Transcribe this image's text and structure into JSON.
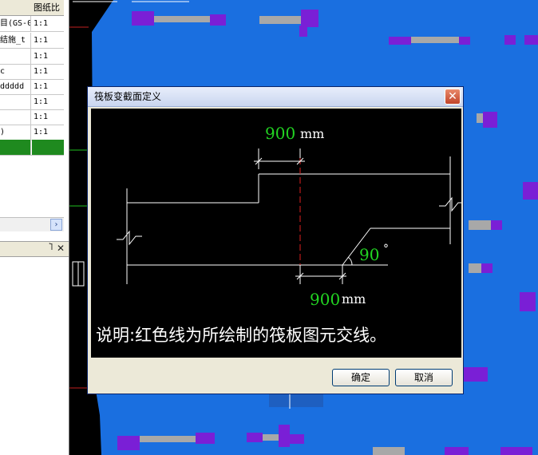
{
  "table": {
    "header_col2": "图纸比",
    "rows": [
      {
        "name": "目(GS-0",
        "scale": "1:1"
      },
      {
        "name": "结施_t",
        "scale": "1:1"
      },
      {
        "name": "",
        "scale": "1:1"
      },
      {
        "name": "c",
        "scale": "1:1"
      },
      {
        "name": "ddddd",
        "scale": "1:1"
      },
      {
        "name": "",
        "scale": "1:1"
      },
      {
        "name": "",
        "scale": "1:1"
      },
      {
        "name": ")",
        "scale": "1:1"
      }
    ]
  },
  "panel2": {
    "pin_glyph": "Ⴈ",
    "close_glyph": "✕"
  },
  "dialog": {
    "title": "筏板变截面定义",
    "close_glyph": "✕",
    "dim_top_value": "900",
    "dim_top_unit": "mm",
    "dim_bottom_value": "900",
    "dim_bottom_unit": "mm",
    "angle_value": "90",
    "angle_unit": "°",
    "note": "说明:红色线为所绘制的筏板图元交线。",
    "ok_label": "确定",
    "cancel_label": "取消"
  },
  "colors": {
    "canvas_blue": "#1a6fe0",
    "member_purple": "#7a1fd6",
    "member_grey": "#a8a8a8",
    "dim_green": "#22d422",
    "cut_line_red": "#e02020",
    "selected_row": "#1f8a1f"
  }
}
